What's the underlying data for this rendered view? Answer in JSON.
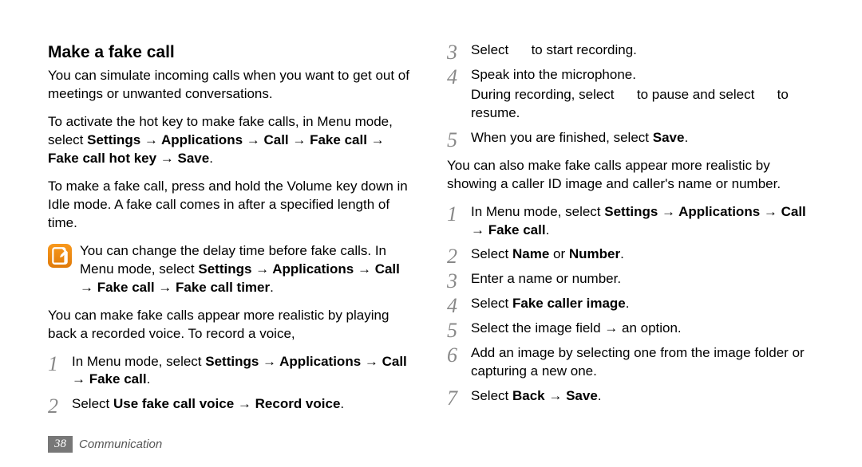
{
  "footer": {
    "page": "38",
    "section": "Communication"
  },
  "left": {
    "heading": "Make a fake call",
    "p1": "You can simulate incoming calls when you want to get out of meetings or unwanted conversations.",
    "p2_pre": "To activate the hot key to make fake calls, in Menu mode, select ",
    "p2_bold": "Settings → Applications → Call → Fake call → Fake call hot key → Save",
    "p2_post": ".",
    "p3": "To make a fake call, press and hold the Volume key down in Idle mode. A fake call comes in after a specified length of time.",
    "note_pre": "You can change the delay time before fake calls. In Menu mode, select ",
    "note_bold": "Settings → Applications → Call → Fake call → Fake call timer",
    "note_post": ".",
    "p4": "You can make fake calls appear more realistic by playing back a recorded voice. To record a voice,",
    "s1_pre": "In Menu mode, select ",
    "s1_bold": "Settings → Applications → Call → Fake call",
    "s1_post": ".",
    "s2_pre": "Select ",
    "s2_bold": "Use fake call voice → Record voice",
    "s2_post": "."
  },
  "right": {
    "s3": "Select      to start recording.",
    "s4a": "Speak into the microphone.",
    "s4b": "During recording, select      to pause and select      to resume.",
    "s5_pre": "When you are finished, select ",
    "s5_bold": "Save",
    "s5_post": ".",
    "p5": "You can also make fake calls appear more realistic by showing a caller ID image and caller's name or number.",
    "b1_pre": "In Menu mode, select ",
    "b1_bold": "Settings → Applications → Call → Fake call",
    "b1_post": ".",
    "b2_pre": "Select ",
    "b2_bold": "Name",
    "b2_mid": " or ",
    "b2_bold2": "Number",
    "b2_post": ".",
    "b3": "Enter a name or number.",
    "b4_pre": "Select ",
    "b4_bold": "Fake caller image",
    "b4_post": ".",
    "b5": "Select the image field → an option.",
    "b6": "Add an image by selecting one from the image folder or capturing a new one.",
    "b7_pre": "Select ",
    "b7_bold": "Back → Save",
    "b7_post": "."
  }
}
